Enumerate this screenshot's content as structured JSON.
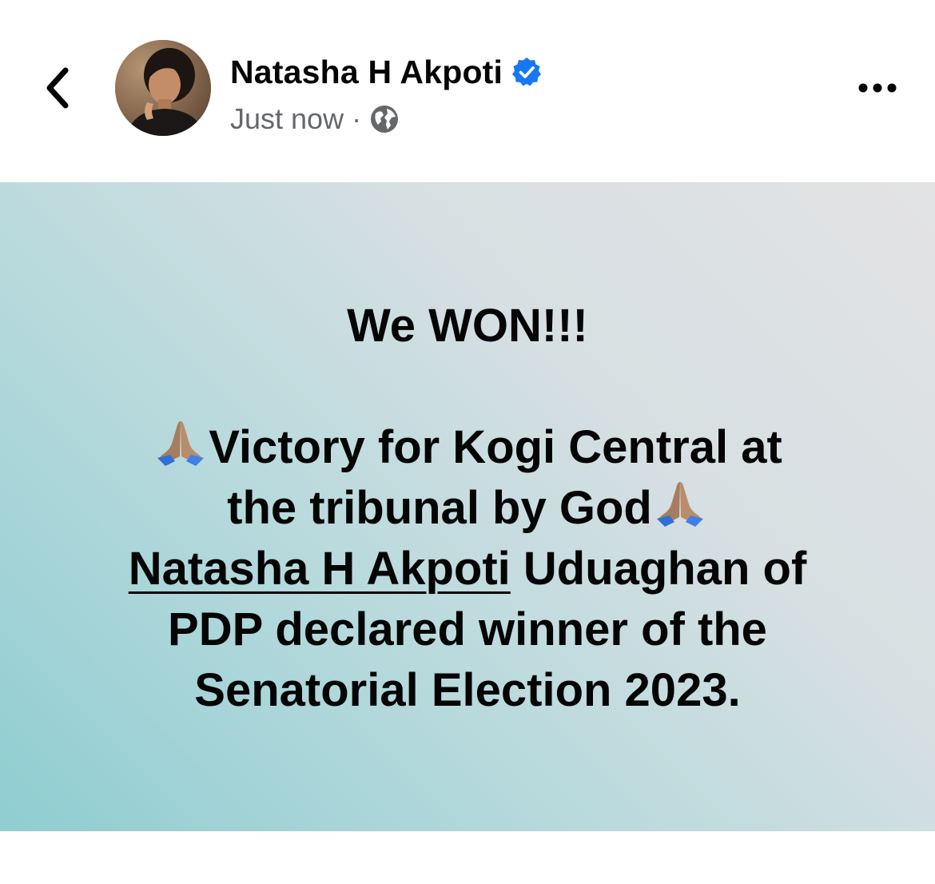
{
  "header": {
    "author_name": "Natasha H Akpoti",
    "timestamp": "Just now",
    "separator": "·",
    "privacy_icon": "globe-icon",
    "verified_icon": "verified-badge-icon",
    "back_icon": "chevron-left-icon",
    "more_icon": "more-horizontal-icon"
  },
  "post": {
    "headline": "We WON!!!",
    "line1": "Victory for Kogi Central at",
    "line2": "the tribunal by God",
    "mention": "Natasha H Akpoti",
    "line3_rest": " Uduaghan of",
    "line4": "PDP declared winner of the",
    "line5": "Senatorial Election 2023.",
    "emoji": "folded-hands-icon"
  },
  "colors": {
    "text_primary": "#050505",
    "text_secondary": "#65676b",
    "verified_blue": "#1877f2",
    "gradient_start": "#8fcdd1",
    "gradient_end": "#e3e3e5"
  }
}
